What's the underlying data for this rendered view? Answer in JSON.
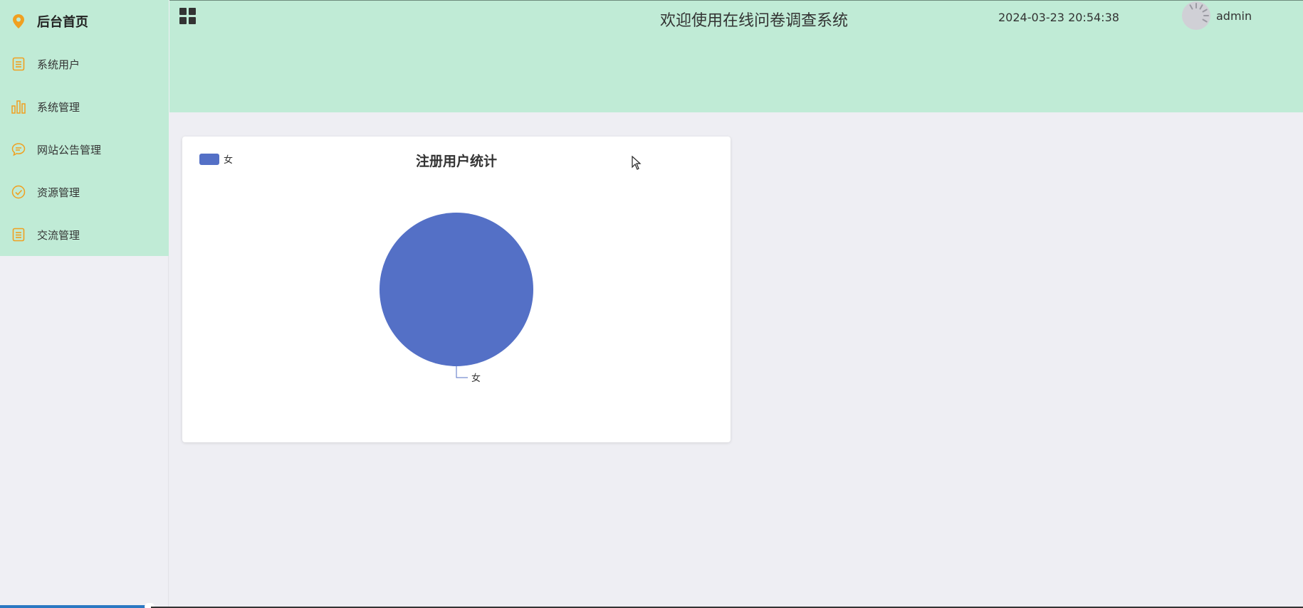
{
  "sidebar": {
    "items": [
      {
        "label": "后台首页",
        "icon": "location-pin-icon"
      },
      {
        "label": "系统用户",
        "icon": "document-icon"
      },
      {
        "label": "系统管理",
        "icon": "bar-chart-icon"
      },
      {
        "label": "网站公告管理",
        "icon": "chat-bubble-icon"
      },
      {
        "label": "资源管理",
        "icon": "check-circle-icon"
      },
      {
        "label": "交流管理",
        "icon": "document-icon"
      }
    ]
  },
  "header": {
    "title": "欢迎使用在线问卷调查系统",
    "datetime": "2024-03-23 20:54:38",
    "username": "admin"
  },
  "colors": {
    "accent_bg": "#c0ebd6",
    "icon": "#f0a020",
    "series": "#5470c6"
  },
  "chart_data": {
    "type": "pie",
    "title": "注册用户统计",
    "legend": [
      "女"
    ],
    "legend_position": "top-left",
    "slices": [
      {
        "label": "女",
        "value": 1
      }
    ]
  }
}
